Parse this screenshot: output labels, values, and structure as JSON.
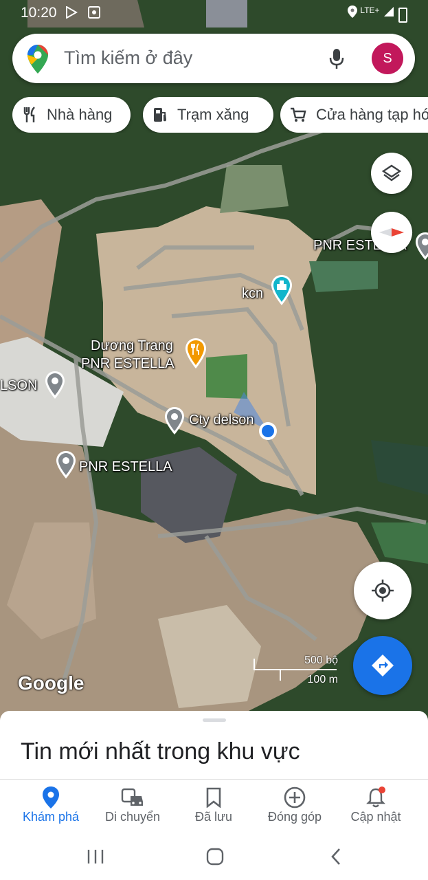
{
  "status": {
    "time": "10:20",
    "network": "LTE+"
  },
  "search": {
    "placeholder": "Tìm kiếm ở đây",
    "avatar_letter": "S"
  },
  "chips": [
    {
      "label": "Nhà hàng",
      "icon": "restaurant-icon"
    },
    {
      "label": "Trạm xăng",
      "icon": "gas-station-icon"
    },
    {
      "label": "Cửa hàng tạp hóa",
      "icon": "cart-icon"
    }
  ],
  "map_labels": {
    "pnr_top_right": "PNR ESTELLA",
    "kcn": "kcn",
    "duong_trang": "Dương Trang",
    "pnr_restaurant": "PNR ESTELLA",
    "delson_left": "LSON",
    "cty_delson": "Cty delson",
    "pnr_bottom": "PNR ESTELLA"
  },
  "map": {
    "google_logo": "Google",
    "scale_top": "500 bộ",
    "scale_bottom": "100 m"
  },
  "sheet": {
    "title": "Tin mới nhất trong khu vực"
  },
  "bottom_nav": [
    {
      "label": "Khám phá",
      "icon": "explore-pin-icon",
      "active": true
    },
    {
      "label": "Di chuyển",
      "icon": "commute-icon",
      "active": false
    },
    {
      "label": "Đã lưu",
      "icon": "bookmark-icon",
      "active": false
    },
    {
      "label": "Đóng góp",
      "icon": "add-circle-icon",
      "active": false
    },
    {
      "label": "Cập nhật",
      "icon": "bell-icon",
      "active": false
    }
  ],
  "colors": {
    "accent": "#1a73e8",
    "avatar": "#c2185b",
    "restaurant_pin": "#f29900",
    "location_dot": "#1a73e8"
  }
}
